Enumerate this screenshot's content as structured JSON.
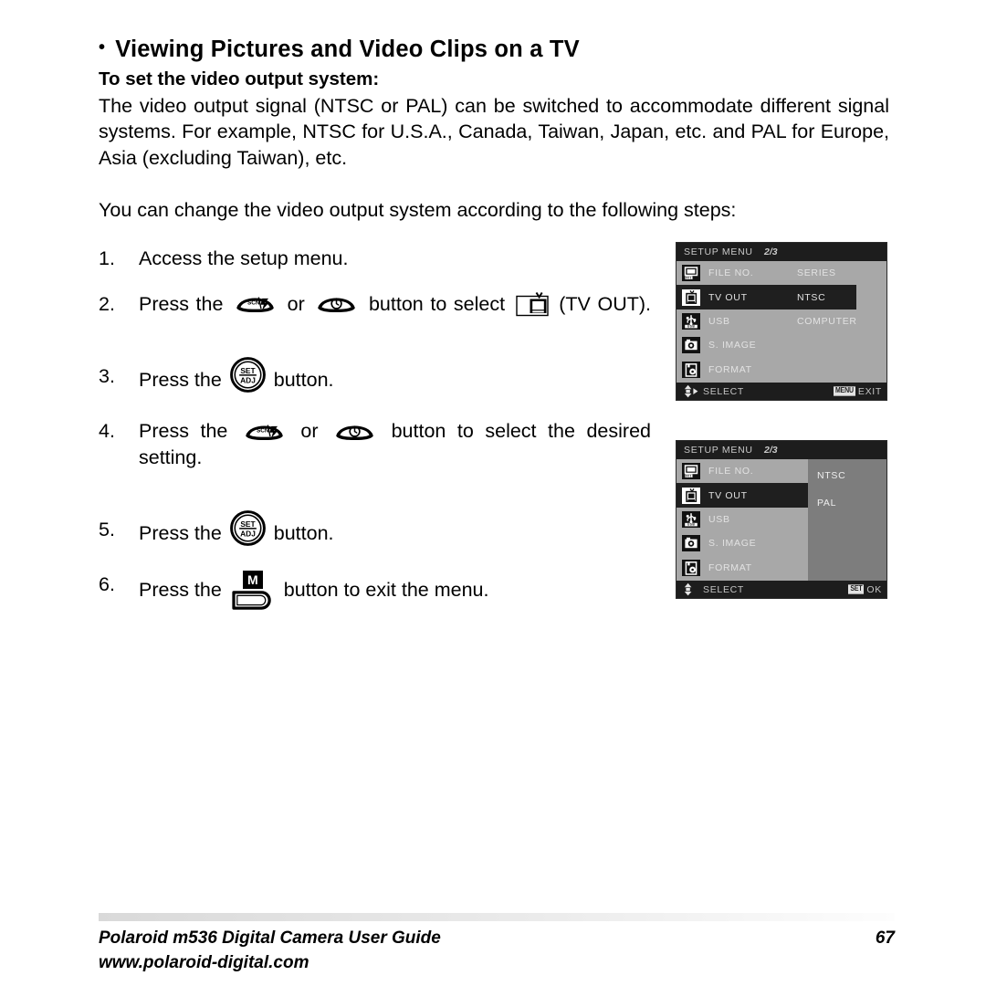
{
  "heading": {
    "bullet": "•",
    "title": "Viewing Pictures and Video Clips on a TV",
    "subtitle": "To set the video output system:"
  },
  "paragraphs": {
    "intro": "The video output signal (NTSC or PAL) can be switched to accommodate different signal systems. For example, NTSC for U.S.A., Canada, Taiwan, Japan, etc. and PAL for Europe, Asia (excluding Taiwan), etc.",
    "lead_in": "You can change the video output system according to the following steps:"
  },
  "steps": [
    {
      "num": "1.",
      "parts": [
        {
          "type": "text",
          "value": "Access the setup menu."
        }
      ]
    },
    {
      "num": "2.",
      "parts": [
        {
          "type": "text",
          "value": "Press the "
        },
        {
          "type": "icon",
          "icon": "scn-flash-button"
        },
        {
          "type": "text",
          "value": " or "
        },
        {
          "type": "icon",
          "icon": "self-timer-button"
        },
        {
          "type": "text",
          "value": " button to select "
        },
        {
          "type": "icon",
          "icon": "tv-out-glyph"
        },
        {
          "type": "text",
          "value": " (TV OUT)."
        }
      ]
    },
    {
      "num": "3.",
      "parts": [
        {
          "type": "text",
          "value": "Press the "
        },
        {
          "type": "icon",
          "icon": "set-adj-button"
        },
        {
          "type": "text",
          "value": " button."
        }
      ]
    },
    {
      "num": "4.",
      "parts": [
        {
          "type": "text",
          "value": "Press the "
        },
        {
          "type": "icon",
          "icon": "scn-flash-button"
        },
        {
          "type": "text",
          "value": " or "
        },
        {
          "type": "icon",
          "icon": "self-timer-button"
        },
        {
          "type": "text",
          "value": " button to select the desired setting."
        }
      ]
    },
    {
      "num": "5.",
      "parts": [
        {
          "type": "text",
          "value": "Press the "
        },
        {
          "type": "icon",
          "icon": "set-adj-button"
        },
        {
          "type": "text",
          "value": " button."
        }
      ]
    },
    {
      "num": "6.",
      "parts": [
        {
          "type": "text",
          "value": "Press the "
        },
        {
          "type": "icon",
          "icon": "menu-button"
        },
        {
          "type": "text",
          "value": " button to exit the menu."
        }
      ]
    }
  ],
  "button_labels": {
    "set": "SET",
    "adj": "ADJ",
    "scn": "SCN",
    "menu_m": "M"
  },
  "lcd_menus": [
    {
      "id": "lcd1",
      "layout": "inline-values",
      "title": "SETUP MENU",
      "page": "2/3",
      "rows": [
        {
          "icon": "file-no-icon",
          "label": "FILE NO.",
          "value": "SERIES",
          "selected": false
        },
        {
          "icon": "tv-out-icon",
          "label": "TV OUT",
          "value": "NTSC",
          "selected": true
        },
        {
          "icon": "usb-icon",
          "label": "USB",
          "value": "COMPUTER",
          "selected": false
        },
        {
          "icon": "s-image-icon",
          "label": "S. IMAGE",
          "value": "",
          "selected": false
        },
        {
          "icon": "format-icon",
          "label": "FORMAT",
          "value": "",
          "selected": false
        }
      ],
      "footer": {
        "arrows": "up-down-right-arrows",
        "select_label": "SELECT",
        "key_badge": "MENU",
        "action_label": "EXIT"
      }
    },
    {
      "id": "lcd2",
      "layout": "submenu-panel",
      "title": "SETUP MENU",
      "page": "2/3",
      "rows": [
        {
          "icon": "file-no-icon",
          "label": "FILE NO.",
          "value": "",
          "selected": false
        },
        {
          "icon": "tv-out-icon",
          "label": "TV OUT",
          "value": "",
          "selected": true
        },
        {
          "icon": "usb-icon",
          "label": "USB",
          "value": "",
          "selected": false
        },
        {
          "icon": "s-image-icon",
          "label": "S. IMAGE",
          "value": "",
          "selected": false
        },
        {
          "icon": "format-icon",
          "label": "FORMAT",
          "value": "",
          "selected": false
        }
      ],
      "submenu_options": [
        "NTSC",
        "PAL"
      ],
      "footer": {
        "arrows": "up-down-arrows",
        "select_label": "SELECT",
        "key_badge": "SET",
        "action_label": "OK"
      }
    }
  ],
  "footer": {
    "guide_title": "Polaroid m536 Digital Camera User Guide",
    "page_number": "67",
    "website": "www.polaroid-digital.com"
  },
  "colors": {
    "page_background": "#ffffff",
    "text": "#000000",
    "lcd_background": "#a8a8a8",
    "lcd_bar": "#1d1d1d",
    "lcd_selected_row": "#1f1f1f",
    "lcd_submenu": "#7d7d7d",
    "lcd_text": "#e2e2e2"
  }
}
